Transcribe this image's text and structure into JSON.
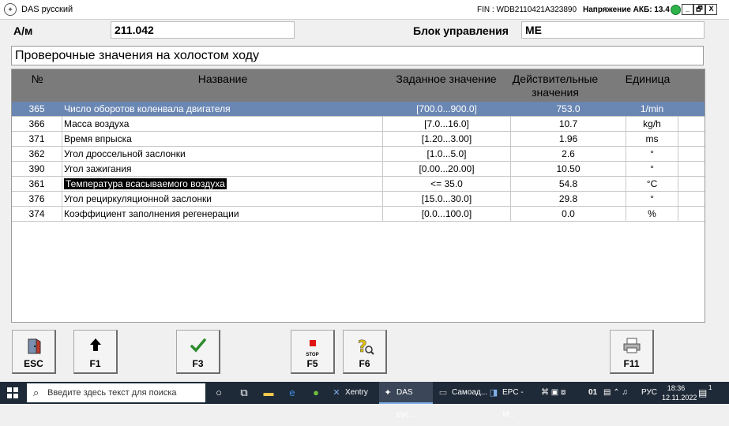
{
  "window": {
    "app_title": "DAS русский",
    "fin": "FIN : WDB2110421A323890",
    "voltage": "Напряжение АКБ: 13.4 V",
    "buttons": [
      "_",
      "🗗",
      "X"
    ]
  },
  "info": {
    "am_label": "А/м",
    "am_value": "211.042",
    "ecu_label": "Блок управления",
    "ecu_value": "ME",
    "screen_title": "Проверочные значения на холостом ходу"
  },
  "table": {
    "headers": {
      "no": "№",
      "name": "Название",
      "setpoint": "Заданное значение",
      "actual_1": "Действительные",
      "actual_2": "значения",
      "unit": "Единица"
    },
    "rows": [
      {
        "no": "365",
        "name": "Число оборотов коленвала двигателя",
        "setpoint": "[700.0...900.0]",
        "actual": "753.0",
        "unit": "1/min"
      },
      {
        "no": "366",
        "name": "Масса воздуха",
        "setpoint": "[7.0...16.0]",
        "actual": "10.7",
        "unit": "kg/h"
      },
      {
        "no": "371",
        "name": "Время впрыска",
        "setpoint": "[1.20...3.00]",
        "actual": "1.96",
        "unit": "ms"
      },
      {
        "no": "362",
        "name": "Угол дроссельной заслонки",
        "setpoint": "[1.0...5.0]",
        "actual": "2.6",
        "unit": "°"
      },
      {
        "no": "390",
        "name": "Угол зажигания",
        "setpoint": "[0.00...20.00]",
        "actual": "10.50",
        "unit": "°"
      },
      {
        "no": "361",
        "name": "Температура всасываемого воздуха",
        "setpoint": "<= 35.0",
        "actual": "54.8",
        "unit": "°C"
      },
      {
        "no": "376",
        "name": "Угол рециркуляционной заслонки",
        "setpoint": "[15.0...30.0]",
        "actual": "29.8",
        "unit": "°"
      },
      {
        "no": "374",
        "name": "Коэффициент заполнения регенерации",
        "setpoint": "[0.0...100.0]",
        "actual": "0.0",
        "unit": "%"
      }
    ]
  },
  "fkeys": {
    "esc": "ESC",
    "f1": "F1",
    "f3": "F3",
    "f5": "F5",
    "f5_icon_text": "STOP",
    "f6": "F6",
    "f11": "F11"
  },
  "taskbar": {
    "search_placeholder": "Введите здесь текст для поиска",
    "apps": {
      "xentry": "Xentry",
      "das": "DAS рус...",
      "samoad": "Самоад...",
      "epc": "EPC - M..."
    },
    "tray_num": "01",
    "lang": "РУС",
    "time": "18:36",
    "date": "12.11.2022",
    "notif_count": "1"
  },
  "colors": {
    "selected_row": "#6a87b4",
    "table_header": "#7b7b7b",
    "status_ok": "#2db34a",
    "taskbar": "#1f2a38"
  }
}
